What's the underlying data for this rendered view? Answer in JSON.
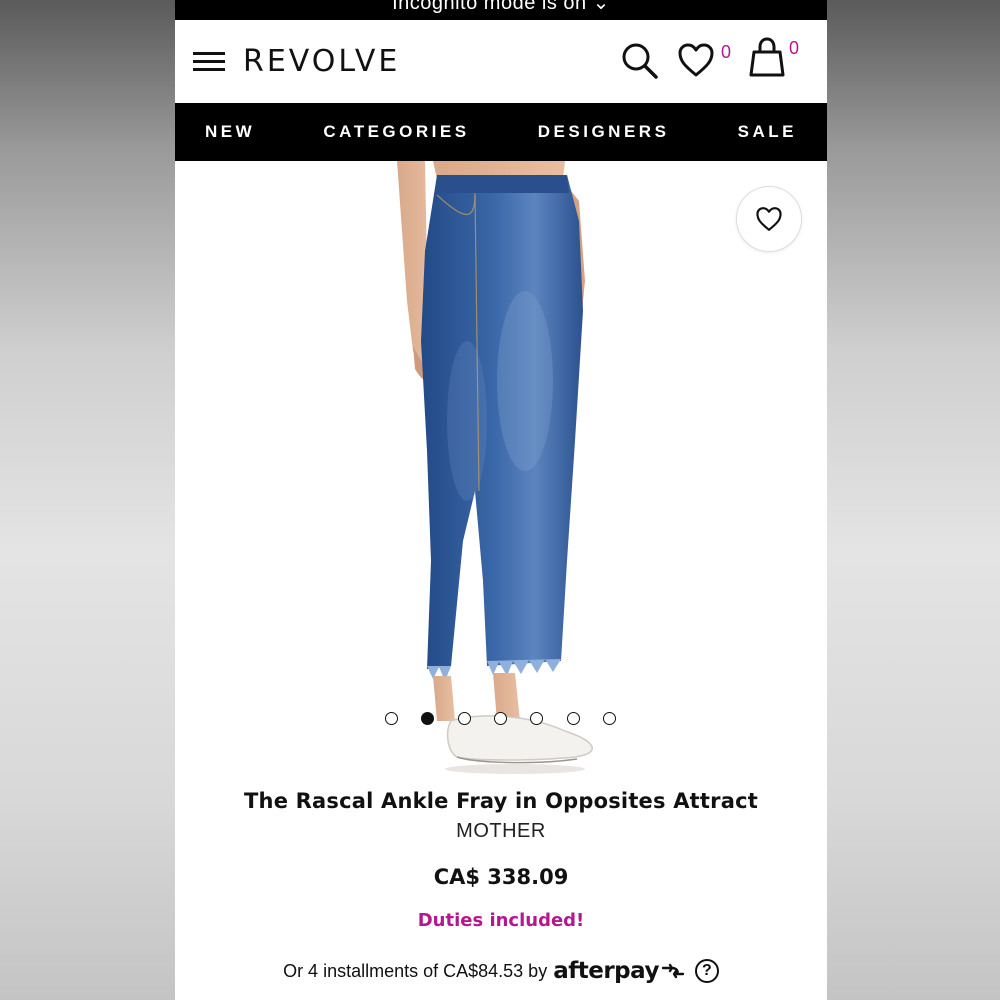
{
  "status_bar": {
    "incognito_text": "Incognito mode is on ⌄"
  },
  "header": {
    "logo": "REVOLVE",
    "wishlist_count": "0",
    "cart_count": "0"
  },
  "nav": {
    "items": [
      {
        "label": "NEW"
      },
      {
        "label": "CATEGORIES"
      },
      {
        "label": "DESIGNERS"
      },
      {
        "label": "SALE"
      }
    ]
  },
  "gallery": {
    "image_count": 7,
    "active_index": 1
  },
  "product": {
    "title": "The Rascal Ankle Fray in Opposites Attract",
    "brand": "MOTHER",
    "price": "CA$ 338.09",
    "duties": "Duties included!",
    "installments_text": "Or 4 installments of CA$84.53 by",
    "installments_provider": "afterpay",
    "help_symbol": "?"
  },
  "colors": {
    "accent": "#b5178c",
    "nav_bg": "#000000",
    "denim": "#2f5a9a"
  }
}
